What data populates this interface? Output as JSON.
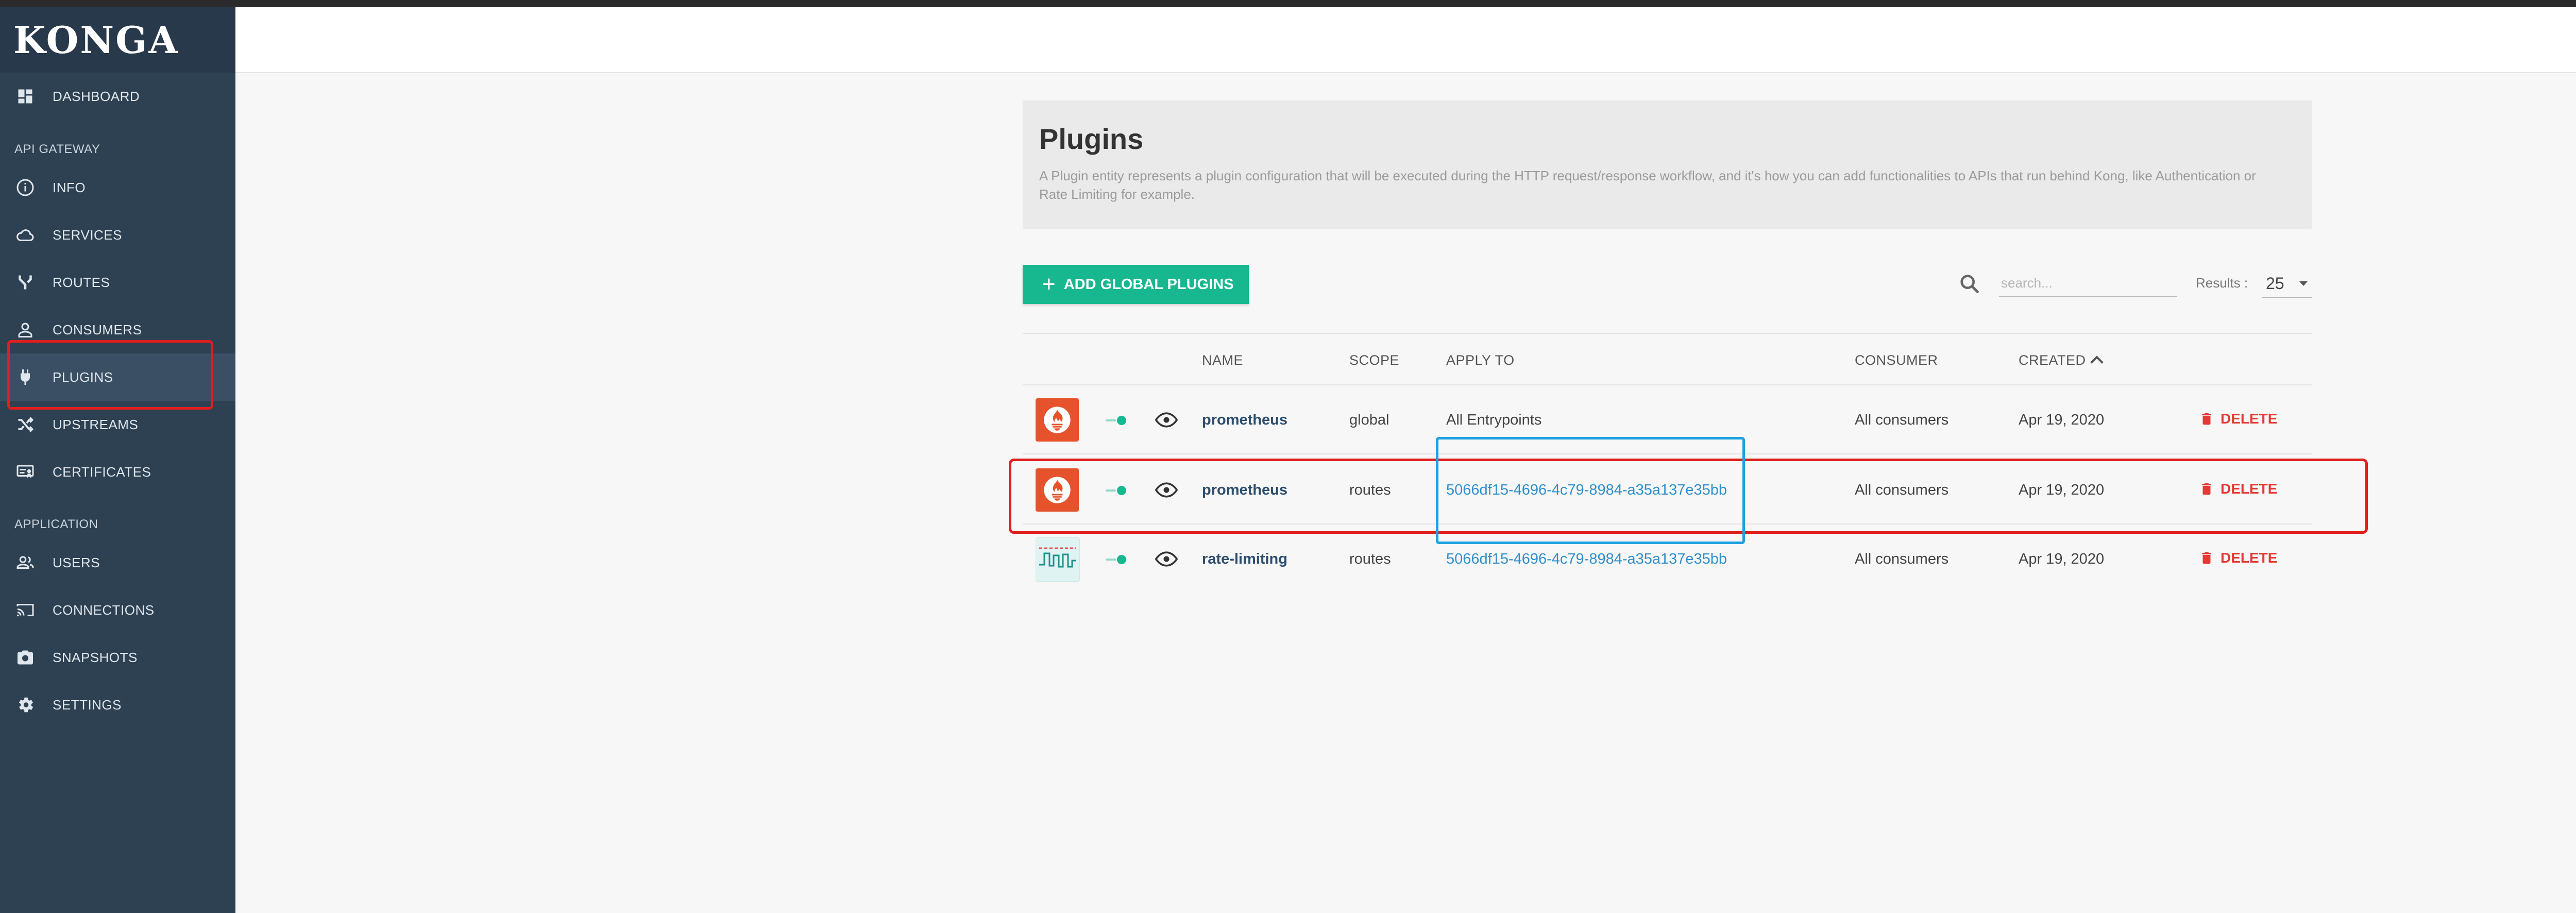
{
  "app": {
    "logo": "KONGA"
  },
  "sidebar": {
    "top_items": [
      {
        "label": "DASHBOARD",
        "icon": "dashboard-icon"
      }
    ],
    "sections": [
      {
        "title": "API GATEWAY",
        "items": [
          {
            "label": "INFO",
            "icon": "info-icon"
          },
          {
            "label": "SERVICES",
            "icon": "cloud-icon"
          },
          {
            "label": "ROUTES",
            "icon": "routes-icon"
          },
          {
            "label": "CONSUMERS",
            "icon": "person-icon"
          },
          {
            "label": "PLUGINS",
            "icon": "plug-icon",
            "active": true
          },
          {
            "label": "UPSTREAMS",
            "icon": "shuffle-icon"
          },
          {
            "label": "CERTIFICATES",
            "icon": "certificate-icon"
          }
        ]
      },
      {
        "title": "APPLICATION",
        "items": [
          {
            "label": "USERS",
            "icon": "users-icon"
          },
          {
            "label": "CONNECTIONS",
            "icon": "cast-icon"
          },
          {
            "label": "SNAPSHOTS",
            "icon": "camera-icon"
          },
          {
            "label": "SETTINGS",
            "icon": "gear-icon"
          }
        ]
      }
    ]
  },
  "plugins_page": {
    "title": "Plugins",
    "description": "A Plugin entity represents a plugin configuration that will be executed during the HTTP request/response workflow, and it's how you can add functionalities to APIs that run behind Kong, like Authentication or Rate Limiting for example.",
    "add_button": "ADD GLOBAL PLUGINS",
    "search_placeholder": "search...",
    "results_label": "Results :",
    "results_value": "25",
    "columns": [
      "NAME",
      "SCOPE",
      "APPLY TO",
      "CONSUMER",
      "CREATED"
    ],
    "rows": [
      {
        "name": "prometheus",
        "scope": "global",
        "apply_to": "All Entrypoints",
        "consumer": "All consumers",
        "created": "Apr 19, 2020",
        "delete": "DELETE",
        "logo": "prometheus-logo"
      },
      {
        "name": "prometheus",
        "scope": "routes",
        "apply_to": "5066df15-4696-4c79-8984-a35a137e35bb",
        "consumer": "All consumers",
        "created": "Apr 19, 2020",
        "delete": "DELETE",
        "logo": "prometheus-logo"
      },
      {
        "name": "rate-limiting",
        "scope": "routes",
        "apply_to": "5066df15-4696-4c79-8984-a35a137e35bb",
        "consumer": "All consumers",
        "created": "Apr 19, 2020",
        "delete": "DELETE",
        "logo": "rate-limiting-logo"
      }
    ]
  },
  "colors": {
    "sidebar_bg": "#2e4152",
    "accent_green": "#17b890",
    "delete_red": "#e53935",
    "link_blue": "#2f8fcb",
    "annotation_red": "#e01e1e",
    "annotation_blue": "#1da1e0"
  }
}
